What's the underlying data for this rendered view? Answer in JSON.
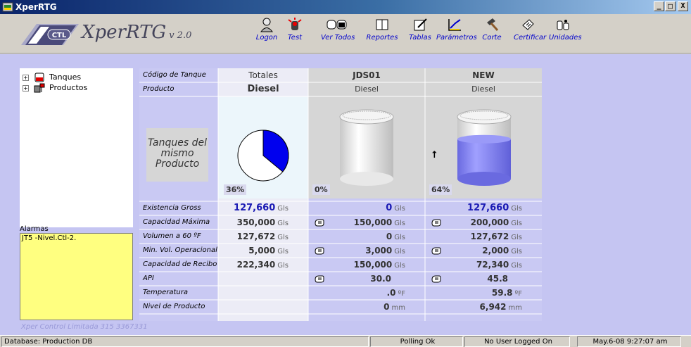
{
  "window": {
    "title": "XperRTG",
    "minimize": "_",
    "maximize": "□",
    "close": "X"
  },
  "toolbar": {
    "app_name": "XperRTG",
    "version": "v 2.0",
    "logo_text": "CTL",
    "buttons": [
      {
        "label": "Logon",
        "icon": "user-icon"
      },
      {
        "label": "Test",
        "icon": "alarm-test-icon"
      },
      {
        "label": "Ver Todos",
        "icon": "tanks-icon"
      },
      {
        "label": "Reportes",
        "icon": "book-icon"
      },
      {
        "label": "Tablas",
        "icon": "table-edit-icon"
      },
      {
        "label": "Parámetros",
        "icon": "parameters-icon"
      },
      {
        "label": "Corte",
        "icon": "hammer-icon"
      },
      {
        "label": "Certificar",
        "icon": "certify-icon"
      },
      {
        "label": "Unidades",
        "icon": "units-icon"
      }
    ]
  },
  "tree": {
    "items": [
      {
        "label": "Tanques",
        "expander": "+",
        "icon": "tank-icon"
      },
      {
        "label": "Productos",
        "expander": "+",
        "icon": "product-icon"
      }
    ]
  },
  "alarms": {
    "label": "Alarmas",
    "entries": [
      "JT5 -Nivel.Ctl-2."
    ]
  },
  "footer_note": "Xper Control Limitada 315 3367331",
  "grid": {
    "row_headers": {
      "tank_code": "Código de Tanque",
      "product": "Producto",
      "gross": "Existencia Gross",
      "max_capacity": "Capacidad Máxima",
      "volume_60": "Volumen a 60 ºF",
      "min_vol": "Min. Vol. Operacional",
      "receipt_cap": "Capacidad de Recibo",
      "api": "API",
      "temperature": "Temperatura",
      "level": "Nivel de Producto"
    },
    "same_product_label": "Tanques del mismo Producto",
    "totals": {
      "code": "Totales",
      "product": "Diesel",
      "pct": "36%",
      "pct_value": 36,
      "gross": "127,660",
      "max_capacity": "350,000",
      "volume_60": "127,672",
      "min_vol": "5,000",
      "receipt_cap": "222,340"
    },
    "tanks": [
      {
        "code": "JDS01",
        "product": "Diesel",
        "pct": "0%",
        "level_fraction": 0,
        "arrow": "",
        "gross": "0",
        "max_capacity": "150,000",
        "volume_60": "0",
        "min_vol": "3,000",
        "receipt_cap": "150,000",
        "api": "30.0",
        "temperature": ".0",
        "level": "0"
      },
      {
        "code": "NEW",
        "product": "Diesel",
        "pct": "64%",
        "level_fraction": 0.64,
        "arrow": "↑",
        "gross": "127,660",
        "max_capacity": "200,000",
        "volume_60": "127,672",
        "min_vol": "2,000",
        "receipt_cap": "72,340",
        "api": "45.8",
        "temperature": "59.8",
        "level": "6,942"
      }
    ],
    "units": {
      "gls": "Gls",
      "temp": "ºF",
      "mm": "mm"
    }
  },
  "statusbar": {
    "database": "Database: Production DB",
    "polling": "Polling Ok",
    "user": "No User Logged On",
    "datetime": "May.6-08  9:27:07 am"
  },
  "colors": {
    "client_bg": "#c5c5f2",
    "pie_fill": "#0000ee",
    "tank_fill": "#8080f0",
    "value_blue": "#1a1ab4"
  }
}
